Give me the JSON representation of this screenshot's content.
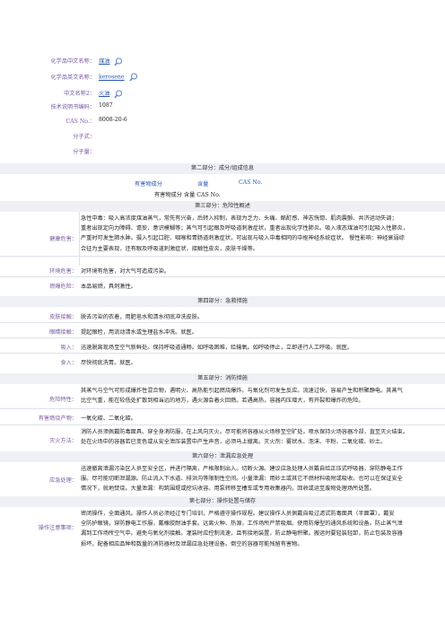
{
  "basic": {
    "cn_name_label": "化学品中文名称：",
    "cn_name": "煤油",
    "en_name_label": "化学品英文名称：",
    "en_name": "kerosene",
    "cn_name2_label": "中文名称2：",
    "cn_name2": "火油",
    "doc_no_label": "技术说明书编码：",
    "doc_no": "1087",
    "cas_label": "CAS No.：",
    "cas": "8008-20-6",
    "formula_label": "分子式：",
    "formula": "",
    "weight_label": "分子量：",
    "weight": ""
  },
  "part2": {
    "title": "第二部分：成分/组成信息",
    "h1": "有害物成分",
    "h2": "含量",
    "h3": "CAS No.",
    "plain": "有害物成分  含量  CAS No."
  },
  "part3": {
    "title": "第三部分：危险性概述",
    "health_label": "健康危害：",
    "health_lines": [
      "急性中毒：吸入高浓度煤油蒸气，常先有兴奋，后转入抑制，表现为乏力、头痛、酩酊感、神志恍惚、肌肉震颤、共济运动失调；",
      "重者出现定向力障碍、谵妄、意识模糊等；蒸气可引起眼及呼吸道刺激症状，重者出现化学性肺炎。吸入液态煤油可引起吸入性肺炎，",
      "严重时可发生肺水肿。摄入引起口腔、咽喉和胃肠道刺激症状，可出现与吸入中毒相同的中枢神经系统症状。 慢性影响：神经衰弱综",
      "合征为主要表现，还有眼及呼吸道刺激症状，接触性皮炎，皮肤干燥等。"
    ],
    "env_label": "环境危害：",
    "env": "对环境有危害，对大气可造成污染。",
    "fire_label": "燃爆危险：",
    "fire": "本品易燃，具刺激性。"
  },
  "part4": {
    "title": "第四部分：急救措施",
    "skin_label": "皮肤接触：",
    "skin": "脱去污染的衣着，用肥皂水和清水彻底冲洗皮肤。",
    "eye_label": "眼睛接触：",
    "eye": "提起眼睑，用流动清水或生理盐水冲洗。就医。",
    "inhale_label": "吸入：",
    "inhale": "迅速脱离现场至空气新鲜处。保持呼吸道通畅。如呼吸困难，给输氧。如呼吸停止，立即进行人工呼吸。就医。",
    "ingest_label": "食入：",
    "ingest": "尽快彻底洗胃。就医。"
  },
  "part5": {
    "title": "第五部分：消防措施",
    "hazard_label": "危险特性：",
    "hazard_lines": [
      "其蒸气与空气可形成爆炸性混合物，遇明火、高热能引起燃烧爆炸。与氧化剂可发生反应。流速过快，容易产生和积聚静电。其蒸气",
      "比空气重，能在较低处扩散到相当远的地方，遇火源会着火回燃。若遇高热，容器内压增大，有开裂和爆炸的危险。"
    ],
    "combust_label": "有害燃烧产物：",
    "combust": "一氧化碳、二氧化碳。",
    "method_label": "灭火方法：",
    "method_lines": [
      "消防人员须佩戴防毒面具、穿全身消防服，在上风向灭火。尽可能将容器从火场移至空旷处。喷水保持火场容器冷却，直至灭火结束。",
      "处在火场中的容器若已变色或从安全泄压装置中产生声音，必须马上撤离。灭火剂：雾状水、泡沫、干粉、二氧化碳、砂土。"
    ]
  },
  "part6": {
    "title": "第六部分：泄漏应急处理",
    "label": "应急处理：",
    "lines": [
      "迅速撤离泄漏污染区人员至安全区，并进行隔离，严格限制出入。切断火源。建议应急处理人员戴自给正压式呼吸器，穿防静电工作",
      "服。尽可能切断泄漏源。防止流入下水道、排洪沟等限制性空间。小量泄漏：用砂土或其它不燃材料吸附或吸收。也可以在保证安全",
      "情况下，就地焚烧。大量泄漏：构筑围堤或挖坑收容。用泵转移至槽车或专用收集器内，回收或运至废物处理场所处置。"
    ]
  },
  "part7": {
    "title": "第七部分：操作处置与储存",
    "label": "操作注意事项：",
    "lines": [
      "密闭操作，全面通风。操作人员必须经过专门培训，严格遵守操作规程。建议操作人员佩戴自吸过滤式防毒面具（半面罩），戴安",
      "全防护眼镜，穿防静电工作服，戴橡胶耐油手套。远离火种、热源，工作场所严禁吸烟。使用防爆型的通风系统和设备。防止蒸气泄",
      "漏到工作场所空气中。避免与氧化剂接触。灌装时应控制流速，且有接地装置，防止静电积聚。搬运时要轻装轻卸，防止包装及容器",
      "损坏。配备相应品种和数量的消防器材及泄漏应急处理设备。倒空的容器可能残留有害物。"
    ]
  }
}
